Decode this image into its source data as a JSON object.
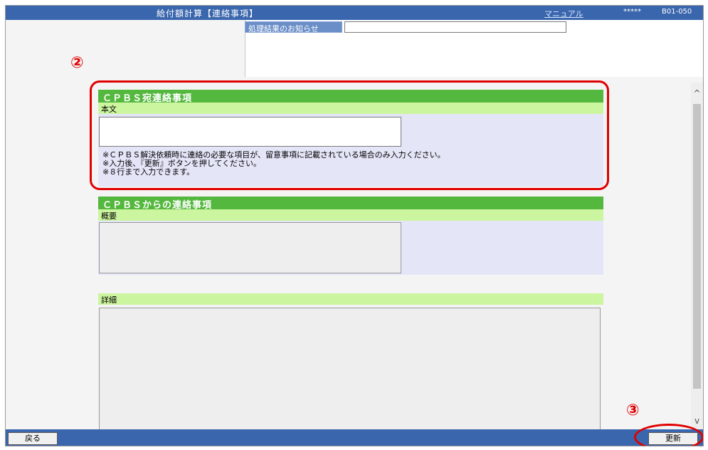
{
  "header": {
    "title": "給付額計算【連絡事項】",
    "manual_link": "マニュアル",
    "masked_user": "*****",
    "screen_id": "B01-050"
  },
  "notice": {
    "label": "処理結果のお知らせ",
    "value": ""
  },
  "annotations": {
    "marker_2": "②",
    "marker_3": "③"
  },
  "section_cpbs_to": {
    "header": "ＣＰＢＳ宛連絡事項",
    "sub_label": "本文",
    "body_value": "",
    "notes": [
      "※ＣＰＢＳ解決依頼時に連絡の必要な項目が、留意事項に記載されている場合のみ入力ください。",
      "※入力後、『更新』ボタンを押してください。",
      "※８行まで入力できます。"
    ]
  },
  "section_cpbs_from": {
    "header": "ＣＰＢＳからの連絡事項",
    "summary_label": "概要",
    "summary_value": "",
    "detail_label": "詳細",
    "detail_value": ""
  },
  "scrollbar": {
    "up_arrow": "^",
    "down_arrow": "v"
  },
  "footer": {
    "back_button": "戻る",
    "update_button": "更新"
  }
}
